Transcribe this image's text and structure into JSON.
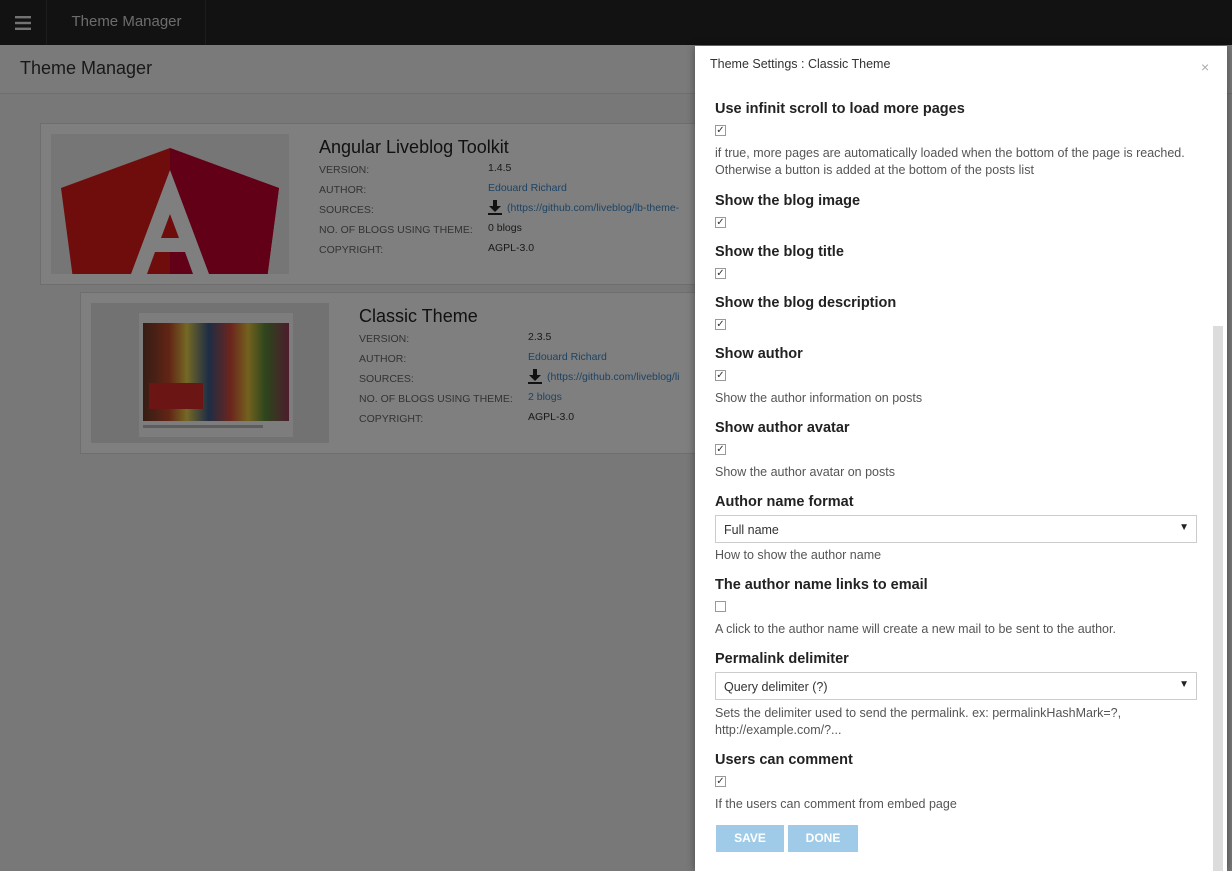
{
  "app": {
    "title": "Theme Manager"
  },
  "page": {
    "title": "Theme Manager"
  },
  "themes": [
    {
      "name": "Angular Liveblog Toolkit",
      "labels": [
        "VERSION:",
        "AUTHOR:",
        "SOURCES:",
        "NO. OF BLOGS USING THEME:",
        "COPYRIGHT:"
      ],
      "version": "1.4.5",
      "author": "Edouard Richard",
      "sources": "(https://github.com/liveblog/lb-theme-",
      "blogs": "0 blogs",
      "copyright": "AGPL-3.0"
    },
    {
      "name": "Classic Theme",
      "labels": [
        "VERSION:",
        "AUTHOR:",
        "SOURCES:",
        "NO. OF BLOGS USING THEME:",
        "COPYRIGHT:"
      ],
      "version": "2.3.5",
      "author": "Edouard Richard",
      "sources": "(https://github.com/liveblog/li",
      "blogs": "2 blogs",
      "copyright": "AGPL-3.0"
    }
  ],
  "modal": {
    "title": "Theme Settings : Classic Theme",
    "close": "×",
    "settings": [
      {
        "label": "Use infinit scroll to load more pages",
        "checked": true,
        "help": "if true, more pages are automatically loaded when the bottom of the page is reached. Otherwise a button is added at the bottom of the posts list"
      },
      {
        "label": "Show the blog image",
        "checked": true
      },
      {
        "label": "Show the blog title",
        "checked": true
      },
      {
        "label": "Show the blog description",
        "checked": true
      },
      {
        "label": "Show author",
        "checked": true,
        "help": "Show the author information on posts"
      },
      {
        "label": "Show author avatar",
        "checked": true,
        "help": "Show the author avatar on posts"
      },
      {
        "label": "Author name format",
        "select": "Full name",
        "help": "How to show the author name"
      },
      {
        "label": "The author name links to email",
        "checked": false,
        "help": "A click to the author name will create a new mail to be sent to the author."
      },
      {
        "label": "Permalink delimiter",
        "select": "Query delimiter (?)",
        "help": "Sets the delimiter used to send the permalink. ex: permalinkHashMark=?, http://example.com/?..."
      },
      {
        "label": "Users can comment",
        "checked": true,
        "help": "If the users can comment from embed page"
      }
    ],
    "buttons": {
      "save": "SAVE",
      "done": "DONE"
    }
  },
  "colors": {
    "topbar": "#242424",
    "overlay": "rgba(0,0,0,0.5)",
    "button": "#9fcbe8",
    "angular_red": "#dd1b16",
    "angular_dark": "#b52e31"
  },
  "icons": {
    "menu": "hamburger-icon",
    "download": "download-icon",
    "close": "close-icon",
    "dropdown": "caret-down-icon"
  }
}
